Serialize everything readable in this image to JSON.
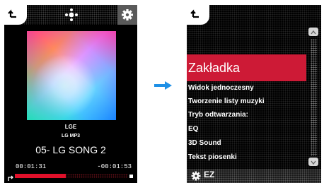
{
  "player": {
    "artist": "LGE",
    "album": "LG MP3",
    "song_title": "05- LG SONG 2",
    "elapsed": "00:01:31",
    "remaining": "-00:01:53",
    "progress_fraction": 0.45
  },
  "menu": {
    "title": "Zakładka",
    "items": [
      "Widok jednoczesny",
      "Tworzenie listy muzyki",
      "Tryb odtwarzania:",
      "EQ",
      "3D Sound",
      "Tekst piosenki"
    ],
    "bottom_label": "EZ"
  },
  "colors": {
    "accent": "#cd1a36",
    "arrow": "#1e90e6"
  },
  "icons": [
    "back-icon",
    "move-icon",
    "gear-icon",
    "repeat-icon",
    "scroll-up-icon",
    "scroll-down-icon",
    "forward-arrow-icon"
  ]
}
